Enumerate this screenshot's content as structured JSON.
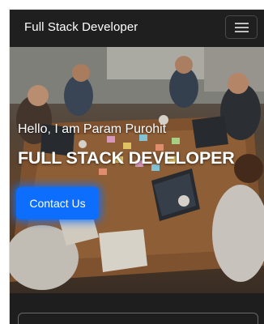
{
  "navbar": {
    "brand": "Full Stack Developer",
    "toggler_icon": "hamburger-menu-icon"
  },
  "hero": {
    "greeting": "Hello, I am Param Purohit",
    "title": "FULL STACK DEVELOPER",
    "contact_button": "Contact Us"
  },
  "colors": {
    "navbar_bg": "#1f1f1f",
    "primary": "#0d6efd",
    "text": "#ffffff",
    "page_bg": "#1b1b1b"
  }
}
